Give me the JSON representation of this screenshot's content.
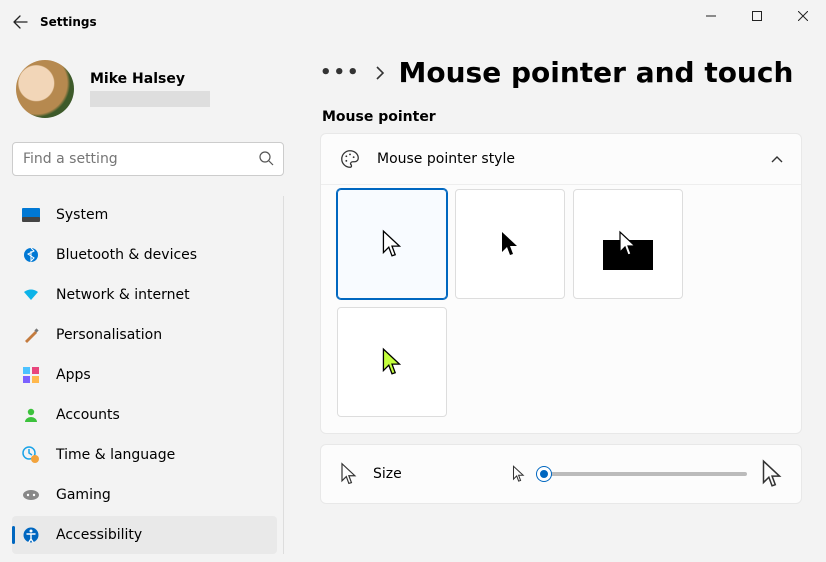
{
  "app": {
    "title": "Settings"
  },
  "user": {
    "name": "Mike Halsey"
  },
  "search": {
    "placeholder": "Find a setting"
  },
  "nav": {
    "items": [
      {
        "label": "System"
      },
      {
        "label": "Bluetooth & devices"
      },
      {
        "label": "Network & internet"
      },
      {
        "label": "Personalisation"
      },
      {
        "label": "Apps"
      },
      {
        "label": "Accounts"
      },
      {
        "label": "Time & language"
      },
      {
        "label": "Gaming"
      },
      {
        "label": "Accessibility"
      }
    ]
  },
  "page": {
    "title": "Mouse pointer and touch",
    "section_label": "Mouse pointer"
  },
  "pointer_style": {
    "label": "Mouse pointer style"
  },
  "size": {
    "label": "Size"
  }
}
